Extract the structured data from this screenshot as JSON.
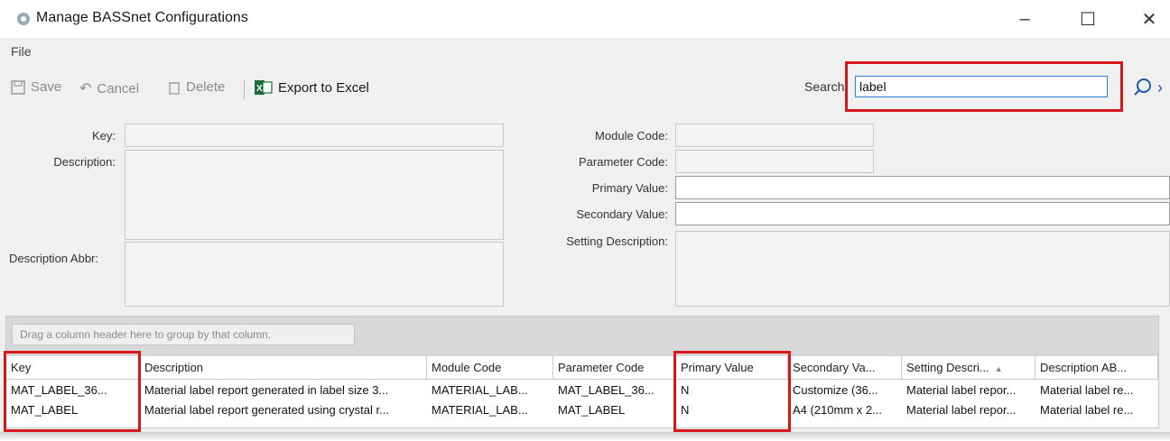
{
  "window": {
    "title": "Manage BASSnet Configurations",
    "icon": "gear-icon",
    "controls": {
      "minimize": "–",
      "maximize": "☐",
      "close": "✕"
    }
  },
  "menu": {
    "file": "File"
  },
  "toolbar": {
    "save": "Save",
    "cancel": "Cancel",
    "delete": "Delete",
    "export": "Export to Excel"
  },
  "search": {
    "label": "Search:",
    "value": "label"
  },
  "form": {
    "key_label": "Key:",
    "description_label": "Description:",
    "description_abbr_label": "Description Abbr:",
    "module_code_label": "Module Code:",
    "parameter_code_label": "Parameter Code:",
    "primary_value_label": "Primary Value:",
    "secondary_value_label": "Secondary Value:",
    "setting_description_label": "Setting Description:"
  },
  "grid": {
    "group_hint": "Drag a column header here to group by that column.",
    "columns": [
      "Key",
      "Description",
      "Module Code",
      "Parameter Code",
      "Primary Value",
      "Secondary Va...",
      "Setting Descri...",
      "Description AB..."
    ],
    "rows": [
      [
        "MAT_LABEL_36...",
        "Material label report generated in label size 3...",
        "MATERIAL_LAB...",
        "MAT_LABEL_36...",
        "N",
        "Customize (36...",
        "Material label repor...",
        "Material label re..."
      ],
      [
        "MAT_LABEL",
        "Material label report generated using crystal r...",
        "MATERIAL_LAB...",
        "MAT_LABEL",
        "N",
        "A4 (210mm x 2...",
        "Material label repor...",
        "Material label re..."
      ]
    ]
  },
  "colors": {
    "highlight": "#d6171b",
    "accent": "#2f7fd8"
  }
}
